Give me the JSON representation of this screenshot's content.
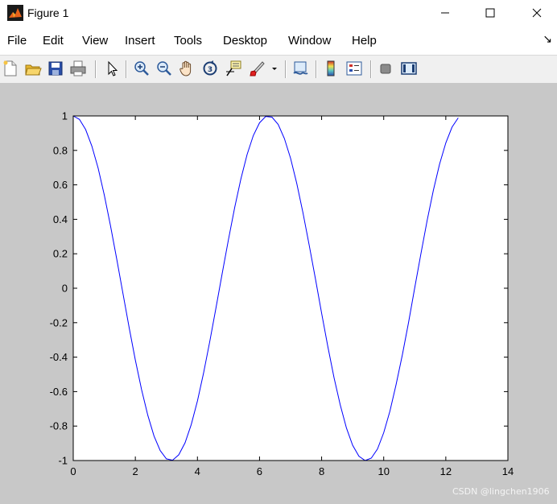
{
  "window": {
    "title": "Figure 1",
    "icon": "matlab-figure-icon"
  },
  "menu": {
    "items": [
      "File",
      "Edit",
      "View",
      "Insert",
      "Tools",
      "Desktop",
      "Window",
      "Help"
    ],
    "overflow_glyph": "↘"
  },
  "toolbar": {
    "icons": [
      "new-figure-icon",
      "open-file-icon",
      "save-icon",
      "print-icon",
      "edit-plot-arrow-icon",
      "zoom-in-icon",
      "zoom-out-icon",
      "pan-hand-icon",
      "rotate-3d-icon",
      "data-cursor-icon",
      "brush-icon",
      "link-plot-icon",
      "colorbar-icon",
      "legend-icon",
      "hide-plot-tools-icon",
      "show-plot-tools-icon"
    ]
  },
  "watermark": "CSDN @lingchen1906",
  "colors": {
    "line": "#0000ff",
    "figure_bg": "#c8c8c8",
    "axes_bg": "#ffffff"
  },
  "chart_data": {
    "type": "line",
    "title": "",
    "xlabel": "",
    "ylabel": "",
    "xlim": [
      0,
      14
    ],
    "ylim": [
      -1,
      1
    ],
    "xticks": [
      "0",
      "2",
      "4",
      "6",
      "8",
      "10",
      "12",
      "14"
    ],
    "yticks": [
      "1",
      "0.8",
      "0.6",
      "0.4",
      "0.2",
      "0",
      "-0.2",
      "-0.4",
      "-0.6",
      "-0.8",
      "-1"
    ],
    "grid": false,
    "series": [
      {
        "color": "#0000ff",
        "x": [
          0,
          0.2,
          0.4,
          0.6,
          0.8,
          1.0,
          1.2,
          1.4,
          1.6,
          1.8,
          2.0,
          2.2,
          2.4,
          2.6,
          2.8,
          3.0,
          3.2,
          3.4,
          3.6,
          3.8,
          4.0,
          4.2,
          4.4,
          4.6,
          4.8,
          5.0,
          5.2,
          5.4,
          5.6,
          5.8,
          6.0,
          6.2,
          6.4,
          6.6,
          6.8,
          7.0,
          7.2,
          7.4,
          7.6,
          7.8,
          8.0,
          8.2,
          8.4,
          8.6,
          8.8,
          9.0,
          9.2,
          9.4,
          9.6,
          9.8,
          10.0,
          10.2,
          10.4,
          10.6,
          10.8,
          11.0,
          11.2,
          11.4,
          11.6,
          11.8,
          12.0,
          12.2,
          12.4
        ],
        "y": [
          1.0,
          0.98,
          0.921,
          0.825,
          0.697,
          0.54,
          0.362,
          0.17,
          -0.029,
          -0.227,
          -0.416,
          -0.589,
          -0.737,
          -0.857,
          -0.942,
          -0.99,
          -0.998,
          -0.967,
          -0.897,
          -0.791,
          -0.654,
          -0.49,
          -0.307,
          -0.112,
          0.087,
          0.284,
          0.469,
          0.635,
          0.776,
          0.886,
          0.96,
          0.997,
          0.993,
          0.951,
          0.869,
          0.754,
          0.608,
          0.438,
          0.251,
          0.054,
          -0.146,
          -0.339,
          -0.519,
          -0.677,
          -0.811,
          -0.911,
          -0.975,
          -0.9999,
          -0.986,
          -0.933,
          -0.839,
          -0.714,
          -0.559,
          -0.386,
          -0.198,
          0.004,
          0.202,
          0.394,
          0.568,
          0.72,
          0.844,
          0.935,
          0.989
        ]
      }
    ]
  }
}
